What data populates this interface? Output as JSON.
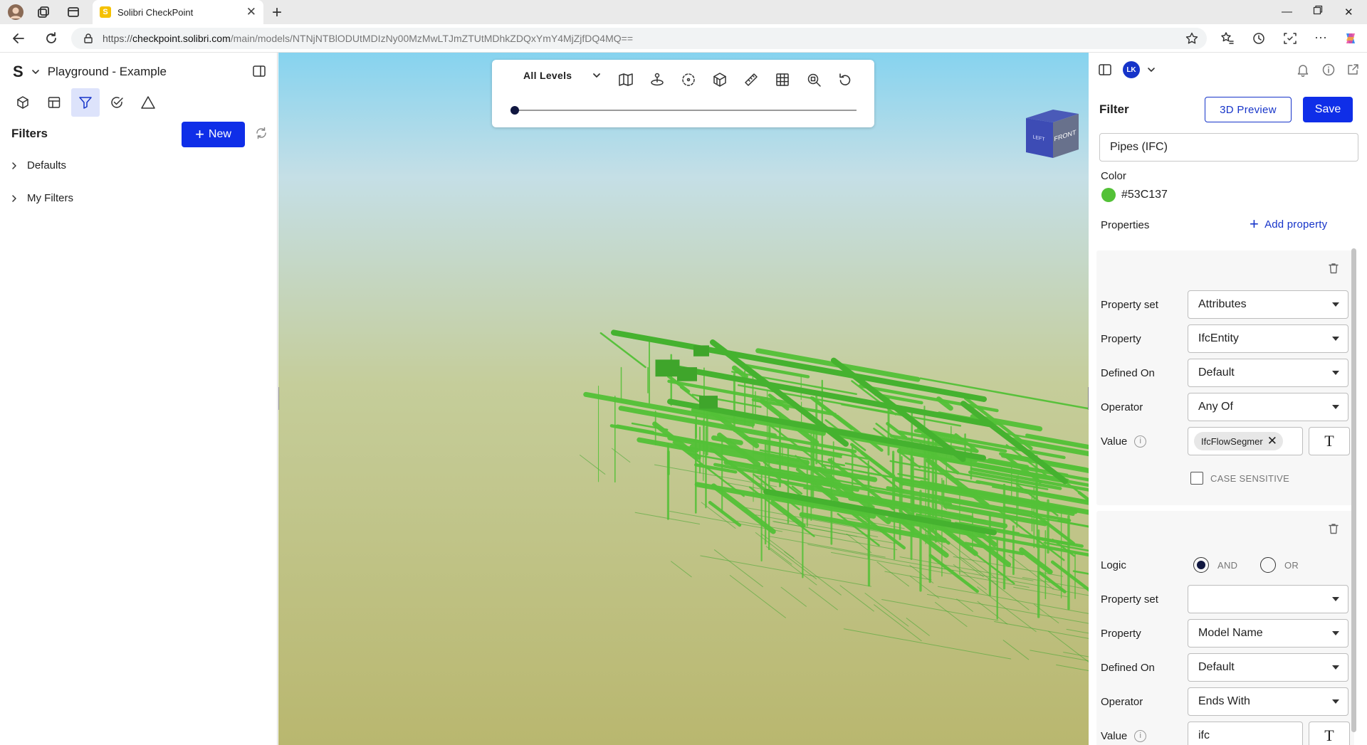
{
  "browser": {
    "tab_title": "Solibri CheckPoint",
    "tab_favicon": "S",
    "url_scheme": "https://",
    "url_host": "checkpoint.solibri.com",
    "url_path": "/main/models/NTNjNTBlODUtMDIzNy00MzMwLTJmZTUtMDhkZDQxYmY4MjZjfDQ4MQ=="
  },
  "left_panel": {
    "logo": "S",
    "project_name": "Playground - Example",
    "mode_tabs": [
      {
        "icon": "model-cube-icon"
      },
      {
        "icon": "layout-icon"
      },
      {
        "icon": "filter-icon",
        "active": true
      },
      {
        "icon": "check-circle-icon"
      },
      {
        "icon": "warning-triangle-icon"
      }
    ],
    "title": "Filters",
    "new_button": "New",
    "tree": [
      {
        "label": "Defaults"
      },
      {
        "label": "My Filters"
      }
    ]
  },
  "viewer": {
    "levels_select": "All Levels",
    "tools": [
      "map-icon",
      "navigate-icon",
      "orbit-icon",
      "section-box-icon",
      "measure-icon",
      "grid-icon",
      "zoom-fit-icon",
      "reset-icon"
    ],
    "navcube_front": "FRONT",
    "navcube_left": "LEFT"
  },
  "right_panel": {
    "user_initials": "LK",
    "title": "Filter",
    "preview_button": "3D Preview",
    "save_button": "Save",
    "filter_name": "Pipes (IFC)",
    "color_label": "Color",
    "color_hex": "#53C137",
    "properties_label": "Properties",
    "add_property": "Add property",
    "conditions": [
      {
        "property_set_label": "Property set",
        "property_set": "Attributes",
        "property_label": "Property",
        "property": "IfcEntity",
        "defined_on_label": "Defined On",
        "defined_on": "Default",
        "operator_label": "Operator",
        "operator": "Any Of",
        "value_label": "Value",
        "value_chip": "IfcFlowSegmer",
        "case_sensitive": "CASE SENSITIVE"
      },
      {
        "logic_label": "Logic",
        "logic_and": "AND",
        "logic_or": "OR",
        "property_set_label": "Property set",
        "property_set": "",
        "property_label": "Property",
        "property": "Model Name",
        "defined_on_label": "Defined On",
        "defined_on": "Default",
        "operator_label": "Operator",
        "operator": "Ends With",
        "value_label": "Value",
        "value": "ifc"
      }
    ]
  },
  "colors": {
    "accent": "#0F2EE8",
    "model_green": "#53C137"
  }
}
